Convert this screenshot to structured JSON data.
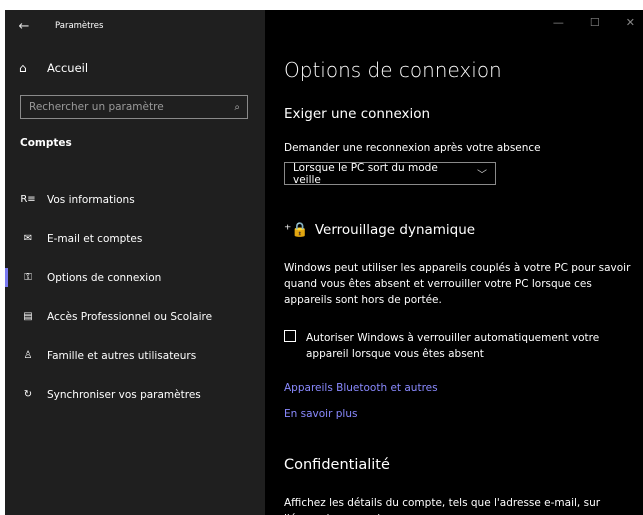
{
  "app_title": "Paramètres",
  "sidebar": {
    "home_label": "Accueil",
    "search_placeholder": "Rechercher un paramètre",
    "section_title": "Comptes",
    "items": [
      {
        "label": "Vos informations"
      },
      {
        "label": "E-mail et comptes"
      },
      {
        "label": "Options de connexion"
      },
      {
        "label": "Accès Professionnel ou Scolaire"
      },
      {
        "label": "Famille et autres utilisateurs"
      },
      {
        "label": "Synchroniser vos paramètres"
      }
    ]
  },
  "main": {
    "title": "Options de connexion",
    "require_heading": "Exiger une connexion",
    "require_desc": "Demander une reconnexion après votre absence",
    "dropdown_value": "Lorsque le PC sort du mode veille",
    "dynamic_lock_heading": "Verrouillage dynamique",
    "dynamic_lock_desc": "Windows peut utiliser les appareils couplés à votre PC pour savoir quand vous êtes absent et verrouiller votre PC lorsque ces appareils sont hors de portée.",
    "checkbox_label": "Autoriser Windows à verrouiller automatiquement votre appareil lorsque vous êtes absent",
    "link_bluetooth": "Appareils Bluetooth et autres",
    "link_learn_more": "En savoir plus",
    "privacy_heading": "Confidentialité",
    "privacy_desc": "Affichez les détails du compte, tels que l'adresse e-mail, sur l'écran de connexion."
  },
  "colors": {
    "sidebar_bg": "#1f1f1f",
    "main_bg": "#000000",
    "accent": "#7a7af0",
    "link": "#8a8aff"
  },
  "icons": {
    "back": "back-arrow-icon",
    "home": "home-icon",
    "search": "search-icon",
    "minimize": "minimize-icon",
    "maximize": "maximize-icon",
    "close": "close-icon"
  }
}
